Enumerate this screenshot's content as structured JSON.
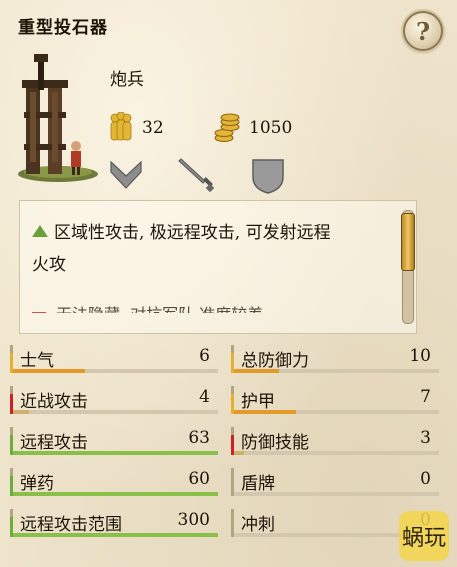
{
  "header": {
    "title": "重型投石器",
    "help_label": "?"
  },
  "unit": {
    "class": "炮兵",
    "men": "32",
    "cost": "1050"
  },
  "description": {
    "line1": "区域性攻击, 极远程攻击, 可发射远程",
    "line2": "火攻",
    "cut_off": "无法隐藏, 对抗军队 准度较差"
  },
  "stats": {
    "left": [
      {
        "label": "士气",
        "value": "6",
        "level": 0.35,
        "color": "#e39a2a",
        "edge": "#e3b030"
      },
      {
        "label": "近战攻击",
        "value": "4",
        "level": 0.08,
        "color": "#d0b070",
        "edge": "#cc2222"
      },
      {
        "label": "远程攻击",
        "value": "63",
        "level": 1.0,
        "color": "#88c04a",
        "edge": "#6cae3a"
      },
      {
        "label": "弹药",
        "value": "60",
        "level": 1.0,
        "color": "#88c04a",
        "edge": "#6cae3a"
      },
      {
        "label": "远程攻击范围",
        "value": "300",
        "level": 1.0,
        "color": "#88c04a",
        "edge": "#6cae3a"
      }
    ],
    "right": [
      {
        "label": "总防御力",
        "value": "10",
        "level": 0.22,
        "color": "#e39a2a",
        "edge": "#e3b030"
      },
      {
        "label": "护甲",
        "value": "7",
        "level": 0.3,
        "color": "#e39a2a",
        "edge": "#e3b030"
      },
      {
        "label": "防御技能",
        "value": "3",
        "level": 0.05,
        "color": "#d0b070",
        "edge": "#cc2222"
      },
      {
        "label": "盾牌",
        "value": "0",
        "level": 0.0,
        "color": "#d0b070",
        "edge": "#b3a582"
      },
      {
        "label": "冲刺",
        "value": "0",
        "level": 0.0,
        "color": "#d0b070",
        "edge": "#b3a582"
      }
    ]
  },
  "colors": {
    "gold": "#d9a928",
    "parchment": "#eee3cb",
    "green": "#88c04a",
    "orange": "#e39a2a"
  },
  "icons": [
    "help-icon",
    "men-icon",
    "gold-coins-icon",
    "chevron-down-icon",
    "sword-icon",
    "shield-icon",
    "green-triangle-icon",
    "scrollbar"
  ]
}
